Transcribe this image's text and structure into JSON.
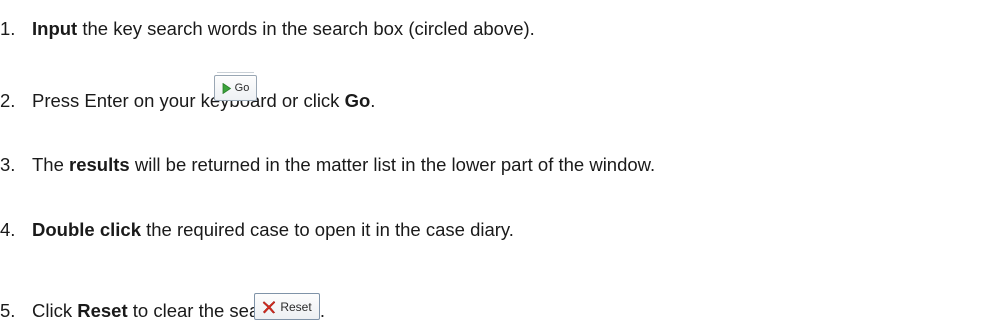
{
  "steps": [
    {
      "number": "1.",
      "bold": "Input",
      "rest": " the key search words in the search box (circled above)."
    },
    {
      "number": "2.",
      "pre": "Press Enter on your keyboard or click ",
      "bold": "Go",
      "post": "."
    },
    {
      "number": "3.",
      "pre": "The ",
      "bold": "results",
      "post": " will be returned in the matter list in the lower part of the window."
    },
    {
      "number": "4.",
      "bold": "Double click",
      "rest": " the required case to open it in the case diary."
    },
    {
      "number": "5.",
      "pre": "Click ",
      "bold": "Reset",
      "post": " to clear the search box."
    }
  ],
  "buttons": {
    "go_label": "Go",
    "reset_label": "Reset"
  },
  "icons": {
    "go_icon": "green-play-arrow-icon",
    "reset_icon": "red-x-icon"
  },
  "colors": {
    "go_arrow": "#3aa33a",
    "reset_x": "#d42a1f"
  }
}
